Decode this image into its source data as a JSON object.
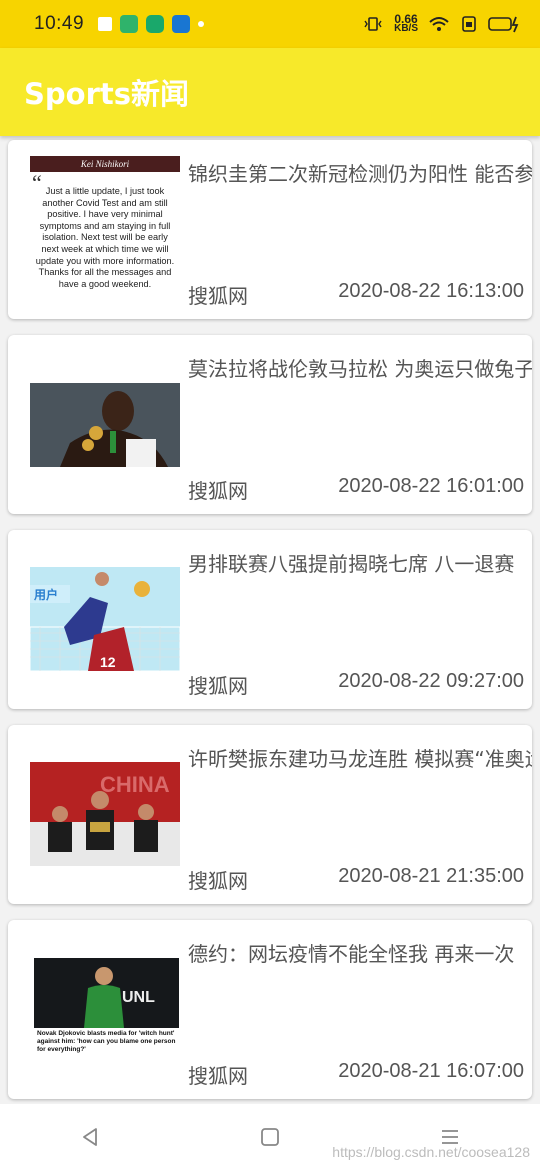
{
  "status": {
    "time": "10:49",
    "net_speed_value": "0.66",
    "net_speed_unit": "KB/S"
  },
  "app": {
    "title": "Sports新闻"
  },
  "news": [
    {
      "title": "锦织圭第二次新冠检测仍为阳性 能否参加美网成疑",
      "source": "搜狐网",
      "time": "2020-08-22 16:13:00",
      "thumb_header": "Kei Nishikori",
      "thumb_text": "Just a little update, I just took another Covid Test and am still positive. I have very minimal symptoms and am staying in full isolation. Next test will be early next week at which time we will update you with more information. Thanks for all the messages and have a good weekend."
    },
    {
      "title": "莫法拉将战伦敦马拉松 为奥运只做兔子",
      "source": "搜狐网",
      "time": "2020-08-22 16:01:00"
    },
    {
      "title": "男排联赛八强提前揭晓七席 八一退赛",
      "source": "搜狐网",
      "time": "2020-08-22 09:27:00"
    },
    {
      "title": "许昕樊振东建功马龙连胜 模拟赛“准奥运”",
      "source": "搜狐网",
      "time": "2020-08-21 21:35:00"
    },
    {
      "title": "德约：网坛疫情不能全怪我 再来一次",
      "source": "搜狐网",
      "time": "2020-08-21 16:07:00",
      "thumb_caption": "Novak Djokovic blasts media for 'witch hunt' against him: 'how can you blame one person for everything?'"
    }
  ],
  "watermark": "https://blog.csdn.net/coosea128"
}
